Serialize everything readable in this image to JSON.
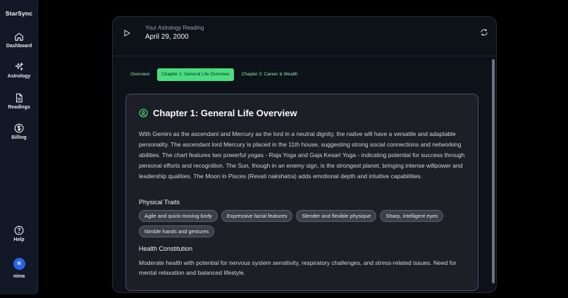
{
  "sidebar": {
    "brand": "StarSync",
    "items": [
      {
        "label": "Dashboard",
        "icon": "home-icon"
      },
      {
        "label": "Astrology",
        "icon": "sparkles-icon"
      },
      {
        "label": "Readings",
        "icon": "document-icon"
      },
      {
        "label": "Billing",
        "icon": "dollar-icon"
      }
    ],
    "help": {
      "label": "Help",
      "icon": "help-icon"
    },
    "user": {
      "initial": "N",
      "name": "nima"
    }
  },
  "header": {
    "subtitle": "Your Astrology Reading",
    "date": "April 29, 2000"
  },
  "tabs": [
    {
      "label": "Overview",
      "active": false
    },
    {
      "label": "Chapter 1: General Life Overview",
      "active": true
    },
    {
      "label": "Chapter 2: Career & Wealth",
      "active": false
    }
  ],
  "chapter": {
    "title": "Chapter 1: General Life Overview",
    "body": "With Gemini as the ascendant and Mercury as the lord in a neutral dignity, the native will have a versatile and adaptable personality. The ascendant lord Mercury is placed in the 11th house, suggesting strong social connections and networking abilities. The chart features two powerful yogas - Raja Yoga and Gaja Kesari Yoga - indicating potential for success through personal efforts and recognition. The Sun, though in an enemy sign, is the strongest planet, bringing intense willpower and leadership qualities. The Moon in Pisces (Revati nakshatra) adds emotional depth and intuitive capabilities.",
    "physical_title": "Physical Traits",
    "traits": [
      "Agile and quick-moving body",
      "Expressive facial features",
      "Slender and flexible physique",
      "Sharp, intelligent eyes",
      "Nimble hands and gestures"
    ],
    "health_title": "Health Constitution",
    "health_body": "Moderate health with potential for nervous system sensitivity, respiratory challenges, and stress-related issues. Need for mental relaxation and balanced lifestyle."
  },
  "colors": {
    "accent": "#4ade80",
    "avatar": "#2563eb"
  }
}
